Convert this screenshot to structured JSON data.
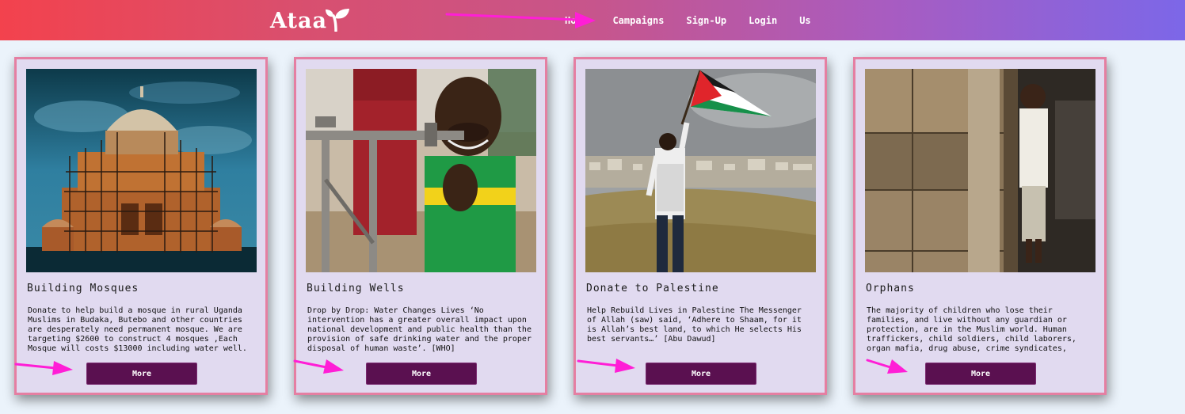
{
  "header": {
    "brand": "Ataa",
    "nav": [
      "Ho",
      "Campaigns",
      "Sign-Up",
      "Login",
      "Us"
    ]
  },
  "colors": {
    "navbar_gradient_start": "#f3424d",
    "navbar_gradient_end": "#7c67e8",
    "card_background": "#e1daf0",
    "card_border": "#e57fa2",
    "button_background": "#5a1050",
    "annotation_arrow": "#ff1ed6"
  },
  "cards": [
    {
      "title": "Building Mosques",
      "image": "mosque-under-scaffolding-photo",
      "description": "Donate to help build a mosque in rural Uganda\nMuslims in Budaka, Butebo and other countries\nare desperately need permanent mosque. We are\ntargeting $2600 to construct 4 mosques ,Each\nMosque will costs $13000 including water well.",
      "button": "More"
    },
    {
      "title": "Building Wells",
      "image": "child-at-water-pipe-photo",
      "description": "Drop by Drop: Water Changes Lives ‘No\nintervention has a greater overall impact upon\nnational development and public health than the\nprovision of safe drinking water and the proper\ndisposal of human waste’. [WHO]",
      "button": "More"
    },
    {
      "title": "Donate to Palestine",
      "image": "man-waving-palestinian-flag-photo",
      "description": "Help Rebuild Lives in Palestine The Messenger\nof Allah (saw) said, ‘Adhere to Shaam, for it\nis Allah’s best land, to which He selects His\nbest servants…’ [Abu Dawud]",
      "button": "More"
    },
    {
      "title": "Orphans",
      "image": "child-by-wooden-shack-photo",
      "description": "The majority of children who lose their\nfamilies, and live without any guardian or\nprotection, are in the Muslim world. Human\ntraffickers, child soldiers, child laborers,\norgan mafia, drug abuse, crime syndicates,",
      "button": "More"
    }
  ]
}
